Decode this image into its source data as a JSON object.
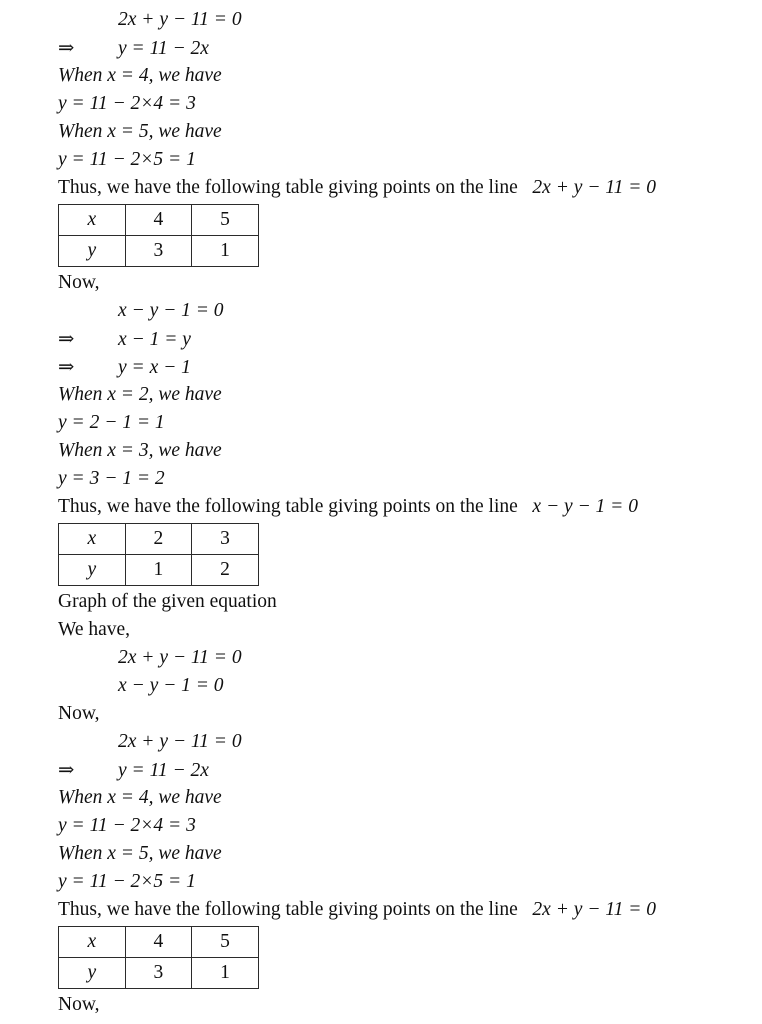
{
  "document": {
    "type": "math-worksheet-solution",
    "background_color": "#ffffff",
    "text_color": "#101010"
  },
  "symbols": {
    "implies": "⇒",
    "times": "×",
    "minus": "−"
  },
  "blocks": {
    "b1_eq1": "2x + y − 11 = 0",
    "b1_eq2": "y = 11 − 2x",
    "b1_when1": "When  x = 4, we have",
    "b1_val1": "y = 11 − 2×4 = 3",
    "b1_when2": "When  x = 5, we have",
    "b1_val2": "y = 11 − 2×5 = 1",
    "b1_thus": "Thus, we have the following table giving points on the line",
    "b1_thus_eq": "2x + y − 11 = 0",
    "now1": "Now,",
    "b2_eq1": "x − y − 1 = 0",
    "b2_eq2": "x − 1 = y",
    "b2_eq3": "y = x − 1",
    "b2_when1": "When  x = 2, we have",
    "b2_val1": "y = 2 − 1 = 1",
    "b2_when2": "When  x = 3, we have",
    "b2_val2": "y = 3 − 1 = 2",
    "b2_thus": "Thus, we have the following table giving points on the line",
    "b2_thus_eq": "x − y − 1 = 0",
    "graph_heading": "Graph of the given equation",
    "we_have": "We have,",
    "b3_eq1": "2x + y − 11 = 0",
    "b3_eq2": "x − y − 1 = 0",
    "now2": "Now,",
    "b4_eq1": "2x + y − 11 = 0",
    "b4_eq2": "y = 11 − 2x",
    "b4_when1": "When  x = 4, we have",
    "b4_val1": "y = 11 − 2×4 = 3",
    "b4_when2": "When  x = 5, we have",
    "b4_val2": "y = 11 − 2×5 = 1",
    "b4_thus": "Thus, we have the following table giving points on the line",
    "b4_thus_eq": "2x + y − 11 = 0",
    "now3": "Now,"
  },
  "tables": [
    {
      "id": "table-1",
      "caption_equation": "2x + y − 11 = 0",
      "rows": [
        {
          "label": "x",
          "values": [
            "4",
            "5"
          ]
        },
        {
          "label": "y",
          "values": [
            "3",
            "1"
          ]
        }
      ]
    },
    {
      "id": "table-2",
      "caption_equation": "x − y − 1 = 0",
      "rows": [
        {
          "label": "x",
          "values": [
            "2",
            "3"
          ]
        },
        {
          "label": "y",
          "values": [
            "1",
            "2"
          ]
        }
      ]
    },
    {
      "id": "table-3",
      "caption_equation": "2x + y − 11 = 0",
      "rows": [
        {
          "label": "x",
          "values": [
            "4",
            "5"
          ]
        },
        {
          "label": "y",
          "values": [
            "3",
            "1"
          ]
        }
      ]
    }
  ]
}
